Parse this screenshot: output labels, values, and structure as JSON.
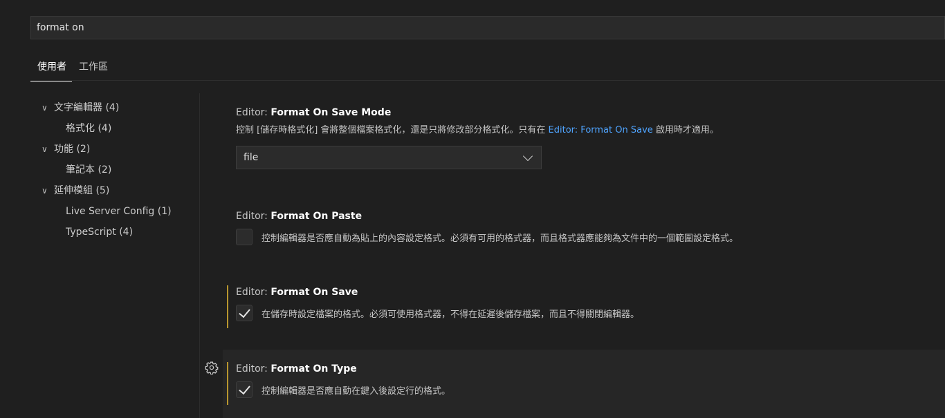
{
  "search": {
    "value": "format on"
  },
  "tabs": [
    {
      "label": "使用者",
      "active": true
    },
    {
      "label": "工作區",
      "active": false
    }
  ],
  "toc": [
    {
      "label": "文字編輯器 (4)",
      "expanded": true,
      "level": 0
    },
    {
      "label": "格式化 (4)",
      "level": 1
    },
    {
      "label": "功能 (2)",
      "expanded": true,
      "level": 0
    },
    {
      "label": "筆記本 (2)",
      "level": 1
    },
    {
      "label": "延伸模組 (5)",
      "expanded": true,
      "level": 0
    },
    {
      "label": "Live Server Config (1)",
      "level": 1
    },
    {
      "label": "TypeScript (4)",
      "level": 1
    }
  ],
  "settings": {
    "save_mode": {
      "category": "Editor:",
      "name": "Format On Save Mode",
      "desc_before": "控制 [儲存時格式化] 會將整個檔案格式化，還是只將修改部分格式化。只有在 ",
      "desc_link": "Editor: Format On Save",
      "desc_after": " 啟用時才適用。",
      "value": "file"
    },
    "on_paste": {
      "category": "Editor:",
      "name": "Format On Paste",
      "checked": false,
      "desc": "控制編輯器是否應自動為貼上的內容設定格式。必須有可用的格式器，而且格式器應能夠為文件中的一個範圍設定格式。"
    },
    "on_save": {
      "category": "Editor:",
      "name": "Format On Save",
      "checked": true,
      "modified": true,
      "desc": "在儲存時設定檔案的格式。必須可使用格式器，不得在延遲後儲存檔案，而且不得關閉編輯器。"
    },
    "on_type": {
      "category": "Editor:",
      "name": "Format On Type",
      "checked": true,
      "modified": true,
      "desc": "控制編輯器是否應自動在鍵入後設定行的格式。"
    }
  },
  "colors": {
    "background": "#1f1f1f",
    "link": "#4fa4ff",
    "modified_indicator": "#b8962e"
  },
  "icons": [
    "chevron-down-icon",
    "gear-icon",
    "check-icon"
  ]
}
